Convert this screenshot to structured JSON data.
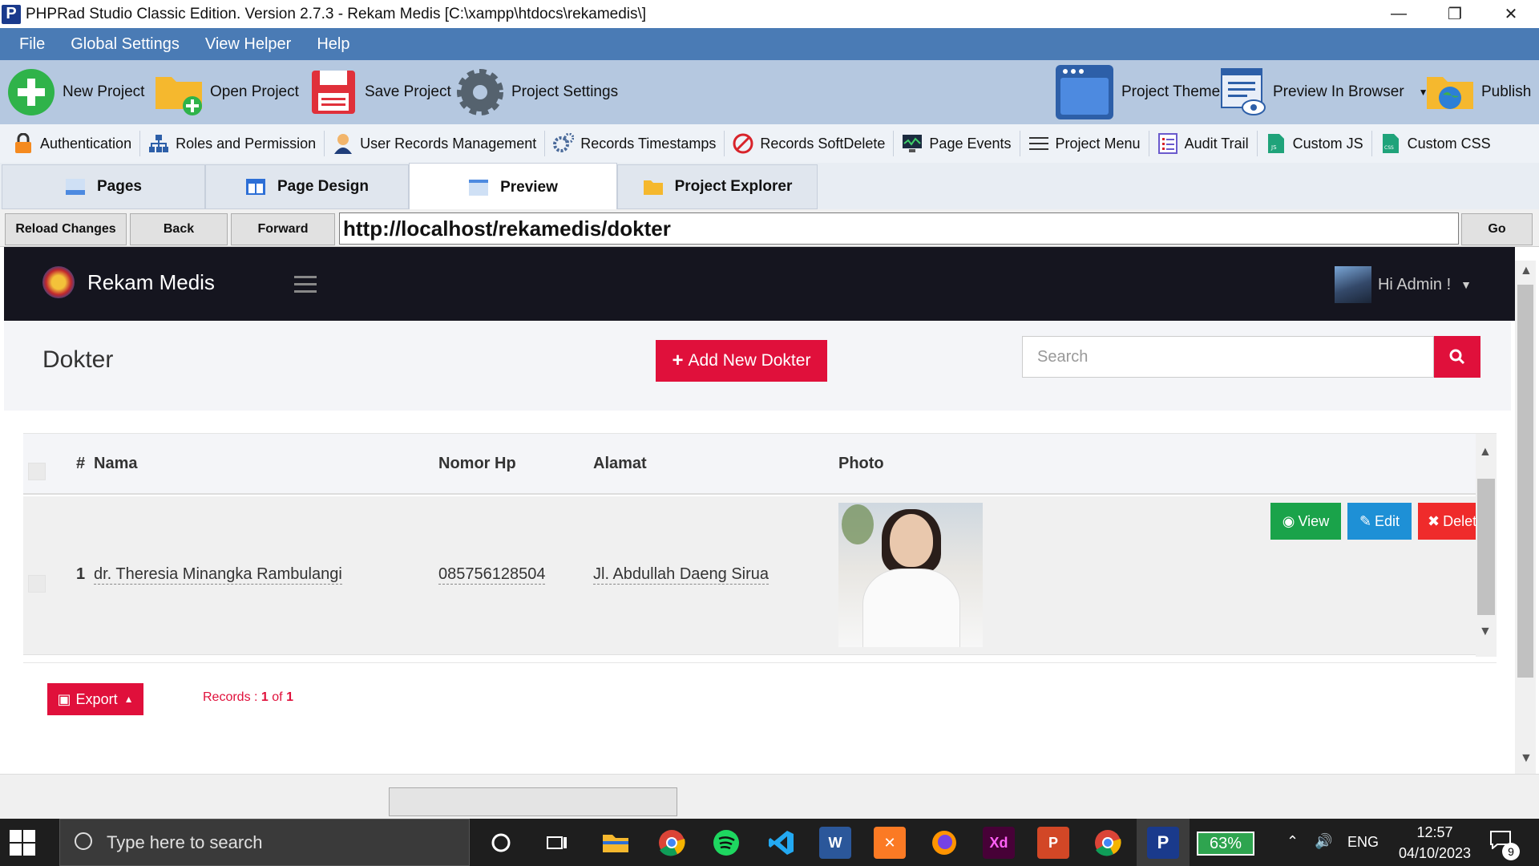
{
  "window": {
    "title": "PHPRad Studio Classic Edition.  Version 2.7.3 - Rekam Medis [C:\\xampp\\htdocs\\rekamedis\\]",
    "app_icon_letter": "P",
    "controls": {
      "minimize": "—",
      "restore": "❐",
      "close": "✕"
    }
  },
  "menubar": [
    "File",
    "Global Settings",
    "View Helper",
    "Help"
  ],
  "toolbar": {
    "new_project": "New Project",
    "open_project": "Open Project",
    "save_project": "Save Project",
    "project_settings": "Project Settings",
    "project_theme": "Project Theme",
    "preview_in_browser": "Preview In Browser",
    "publish": "Publish"
  },
  "toolbar2": [
    {
      "label": "Authentication",
      "icon": "lock-icon"
    },
    {
      "label": "Roles and Permission",
      "icon": "hierarchy-icon"
    },
    {
      "label": "User Records Management",
      "icon": "user-icon"
    },
    {
      "label": "Records Timestamps",
      "icon": "gears-icon"
    },
    {
      "label": "Records SoftDelete",
      "icon": "ban-icon"
    },
    {
      "label": "Page Events",
      "icon": "monitor-icon"
    },
    {
      "label": "Project Menu",
      "icon": "menu-icon"
    },
    {
      "label": "Audit Trail",
      "icon": "list-icon"
    },
    {
      "label": "Custom JS",
      "icon": "js-file-icon"
    },
    {
      "label": "Custom CSS",
      "icon": "css-file-icon"
    }
  ],
  "tabs": [
    "Pages",
    "Page Design",
    "Preview",
    "Project Explorer"
  ],
  "nav": {
    "reload": "Reload Changes",
    "back": "Back",
    "forward": "Forward",
    "url": "http://localhost/rekamedis/dokter",
    "go": "Go"
  },
  "site": {
    "brand": "Rekam Medis",
    "user_greeting": "Hi Admin !",
    "page_title": "Dokter",
    "add_button": "Add New Dokter",
    "search_placeholder": "Search",
    "table": {
      "headers": {
        "num": "#",
        "nama": "Nama",
        "nomor_hp": "Nomor Hp",
        "alamat": "Alamat",
        "photo": "Photo"
      },
      "rows": [
        {
          "num": "1",
          "nama": "dr. Theresia Minangka Rambulangi",
          "nomor_hp": "085756128504",
          "alamat": "Jl. Abdullah Daeng Sirua"
        }
      ],
      "actions": {
        "view": "View",
        "edit": "Edit",
        "delete": "Delete"
      }
    },
    "export_label": "Export",
    "records": {
      "prefix": "Records :",
      "current": "1",
      "of": "of",
      "total": "1"
    }
  },
  "taskbar": {
    "search_placeholder": "Type here to search",
    "battery": "63%",
    "lang": "ENG",
    "time": "12:57",
    "date": "04/10/2023",
    "notifications": "9"
  },
  "colors": {
    "menubar": "#4a7bb5",
    "toolbar": "#b5c8e0",
    "accent_red": "#e0103b",
    "view_green": "#1aa34a",
    "edit_blue": "#1e90d6",
    "delete_red": "#ef2b2b",
    "site_header": "#15151f"
  }
}
